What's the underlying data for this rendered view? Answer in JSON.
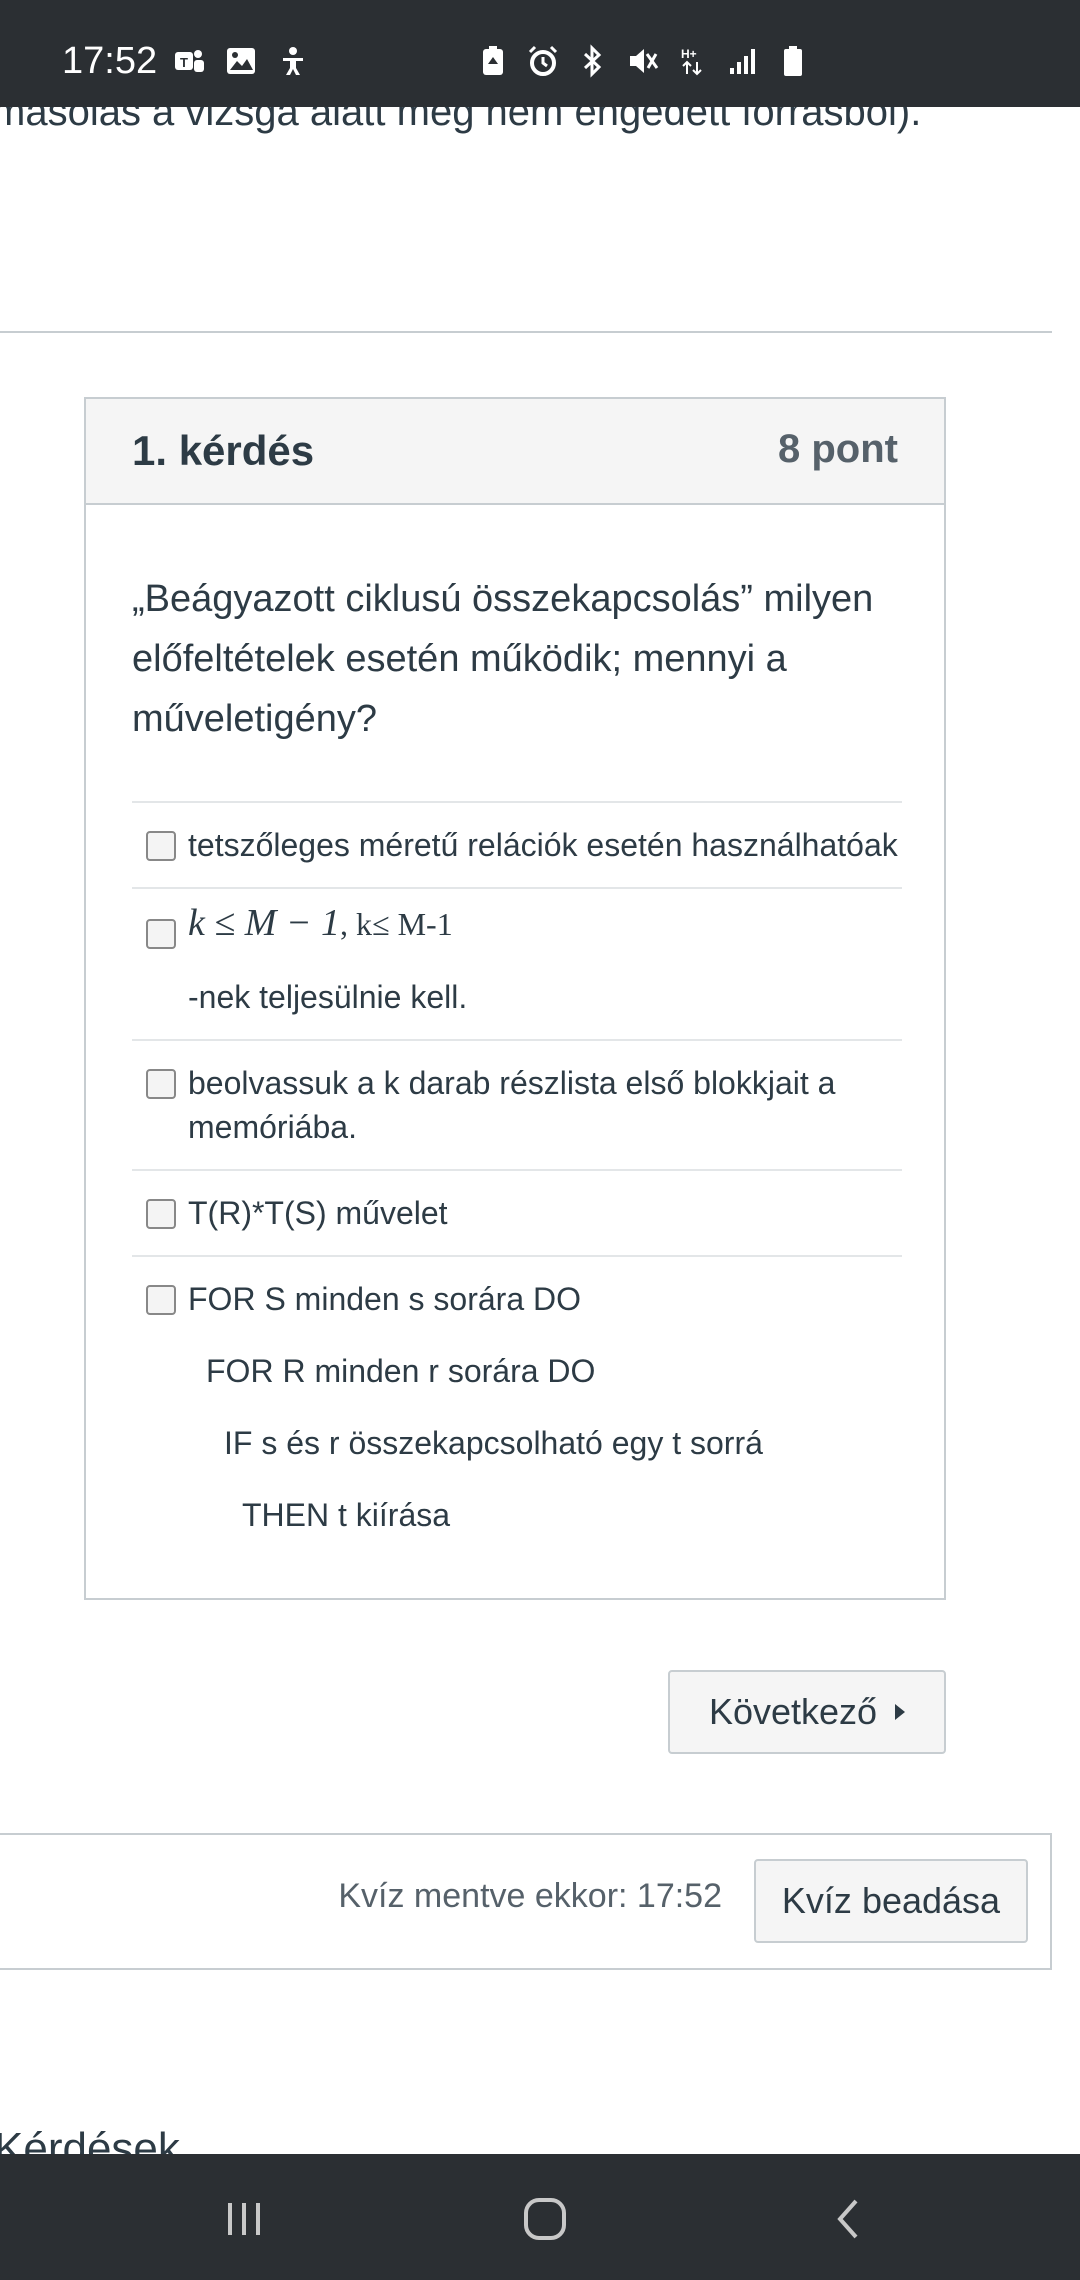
{
  "status_bar": {
    "time": "17:52",
    "left_icons": [
      "teams-icon",
      "gallery-icon",
      "accessibility-icon"
    ],
    "right_icons": [
      "battery-saver-icon",
      "alarm-icon",
      "bluetooth-icon",
      "mute-icon",
      "hplus-data-icon",
      "signal-icon",
      "battery-icon"
    ]
  },
  "page": {
    "cut_off_top_text": "másolás a vizsga alatt még nem engedett forrásból).",
    "cut_off_bottom_text": "Kérdések"
  },
  "question": {
    "title": "1. kérdés",
    "points": "8 pont",
    "text": "„Beágyazott ciklusú összekapcsolás” milyen előfeltételek esetén működik; mennyi a műveletigény?",
    "answers": [
      {
        "lines": [
          "tetszőleges méretű relációk esetén használhatóak"
        ]
      },
      {
        "math": "k ≤ M − 1",
        "math_plain": ", k≤ M-1",
        "lines": [
          "-nek teljesülnie kell."
        ]
      },
      {
        "lines": [
          "beolvassuk a k darab részlista első blokkjait a",
          "memóriába."
        ]
      },
      {
        "lines": [
          "T(R)*T(S) művelet"
        ]
      },
      {
        "lines": [
          "FOR S minden s sorára DO",
          "FOR R minden r sorára DO",
          "IF s és r összekapcsolható egy t sorrá",
          "THEN t kiírása"
        ]
      }
    ]
  },
  "next_button": {
    "label": "Következő"
  },
  "footer": {
    "saved_text": "Kvíz mentve ekkor: 17:52",
    "submit_label": "Kvíz beadása"
  },
  "nav_bar": {
    "icons": [
      "recent-apps-icon",
      "home-icon",
      "back-icon"
    ]
  }
}
